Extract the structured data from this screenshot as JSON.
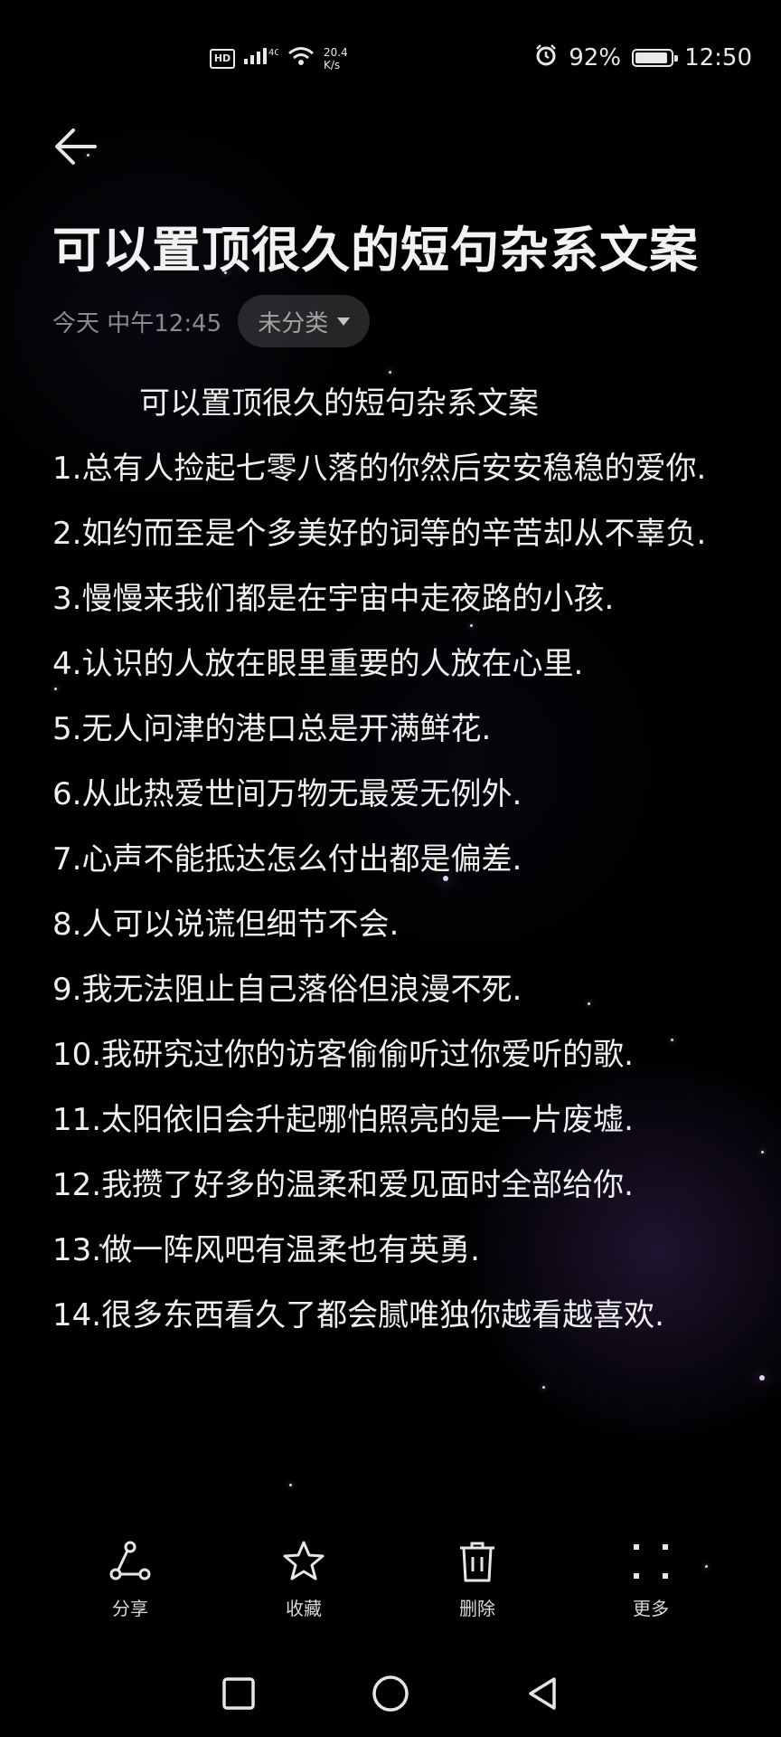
{
  "status_bar": {
    "left_icons": [
      "hd-icon",
      "signal-icon",
      "wifi-icon"
    ],
    "net_speed_value": "20.4",
    "net_speed_unit": "K/s",
    "alarm_icon": "alarm-icon",
    "battery_percent_text": "92%",
    "battery_level": 0.92,
    "time": "12:50"
  },
  "header": {
    "back_icon": "back-arrow-icon",
    "title": "可以置顶很久的短句杂系文案",
    "date": "今天 中午12:45",
    "category_label": "未分类",
    "category_icon": "caret-down-icon"
  },
  "note": {
    "heading": "可以置顶很久的短句杂系文案",
    "lines": [
      "1.总有人捡起七零八落的你然后安安稳稳的爱你.",
      "2.如约而至是个多美好的词等的辛苦却从不辜负.",
      "3.慢慢来我们都是在宇宙中走夜路的小孩.",
      "4.认识的人放在眼里重要的人放在心里.",
      "5.无人问津的港口总是开满鲜花.",
      "6.从此热爱世间万物无最爱无例外.",
      "7.心声不能抵达怎么付出都是偏差.",
      "8.人可以说谎但细节不会.",
      "9.我无法阻止自己落俗但浪漫不死.",
      "10.我研究过你的访客偷偷听过你爱听的歌.",
      "11.太阳依旧会升起哪怕照亮的是一片废墟.",
      "12.我攒了好多的温柔和爱见面时全部给你.",
      "13.做一阵风吧有温柔也有英勇.",
      "14.很多东西看久了都会腻唯独你越看越喜欢."
    ]
  },
  "toolbar": {
    "share_label": "分享",
    "favorite_label": "收藏",
    "delete_label": "删除",
    "more_label": "更多",
    "icons": [
      "share-icon",
      "star-icon",
      "trash-icon",
      "more-dots-icon"
    ]
  },
  "navbar": {
    "icons": [
      "recent-apps-icon",
      "home-icon",
      "back-triangle-icon"
    ]
  },
  "colors": {
    "background": "#000000",
    "text": "#f0f0f0",
    "muted": "#8b8b8b",
    "chip_bg": "#3a3a3c"
  }
}
